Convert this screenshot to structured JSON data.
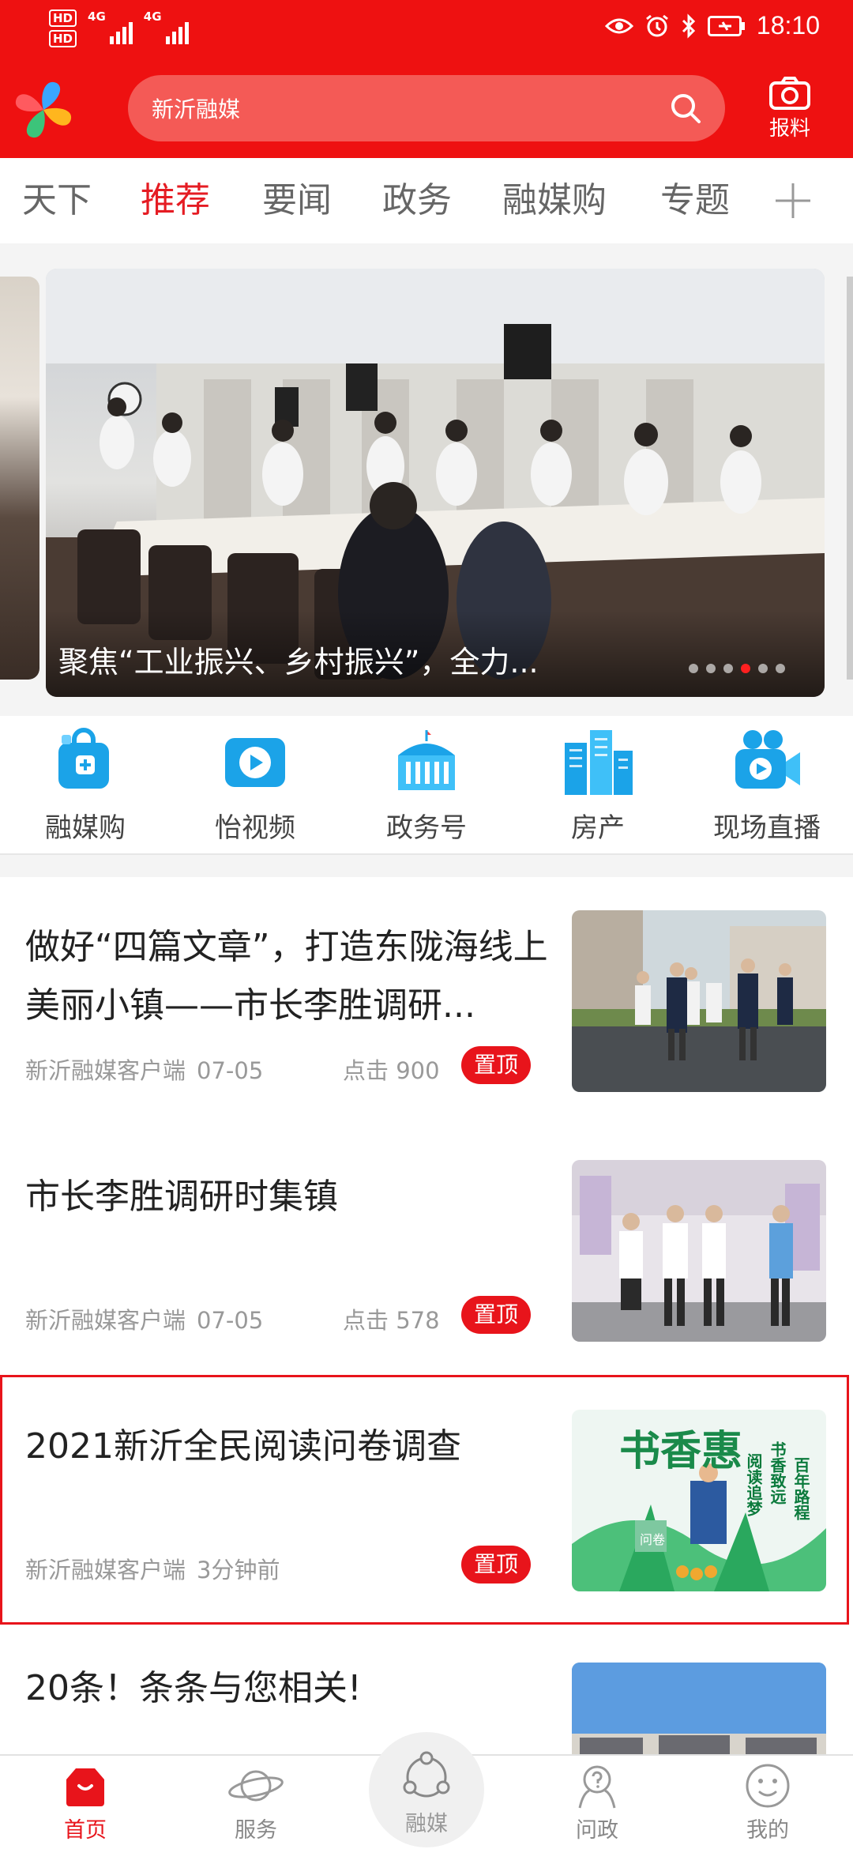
{
  "status_bar": {
    "hd1": "HD",
    "hd2": "HD",
    "net1": "4G",
    "net2": "4G",
    "time": "18:10"
  },
  "header": {
    "search_text": "新沂融媒",
    "report_label": "报料"
  },
  "tabs": [
    "天下",
    "推荐",
    "要闻",
    "政务",
    "融媒购",
    "专题"
  ],
  "active_tab": "推荐",
  "banner": {
    "title": "聚焦“工业振兴、乡村振兴”，全力..."
  },
  "quicknav": {
    "items": [
      {
        "label": "融媒购",
        "icon": "shopping-bag-icon"
      },
      {
        "label": "怡视频",
        "icon": "video-play-icon"
      },
      {
        "label": "政务号",
        "icon": "government-building-icon"
      },
      {
        "label": "房产",
        "icon": "buildings-icon"
      },
      {
        "label": "现场直播",
        "icon": "live-camera-icon"
      }
    ]
  },
  "news": [
    {
      "title": "做好“四篇文章”，打造东陇海线上美丽小镇——市长李胜调研...",
      "source": "新沂融媒客户端",
      "date": "07-05",
      "clicks": "点击 900",
      "pin": "置顶"
    },
    {
      "title": "市长李胜调研时集镇",
      "source": "新沂融媒客户端",
      "date": "07-05",
      "clicks": "点击 578",
      "pin": "置顶"
    },
    {
      "title": "2021新沂全民阅读问卷调查",
      "source": "新沂融媒客户端",
      "date": "3分钟前",
      "pin": "置顶",
      "thumb_text": {
        "left_vertical": "书香惠",
        "tag": "问卷",
        "right_col1": "阅读追梦",
        "right_col2": "书香致远",
        "right_col3": "百年路程"
      }
    },
    {
      "title": "20条！条条与您相关!"
    }
  ],
  "bottom_nav": {
    "items": [
      {
        "label": "首页",
        "icon": "home-icon"
      },
      {
        "label": "服务",
        "icon": "planet-icon"
      },
      {
        "label": "融媒",
        "icon": "share-hub-icon"
      },
      {
        "label": "问政",
        "icon": "question-person-icon"
      },
      {
        "label": "我的",
        "icon": "smiley-icon"
      }
    ],
    "active": "首页"
  },
  "colors": {
    "brand_red": "#ee1111",
    "active_tab": "#e51c23",
    "pin_badge": "#e8141b",
    "quicknav_blue": "#1ba3e8"
  }
}
